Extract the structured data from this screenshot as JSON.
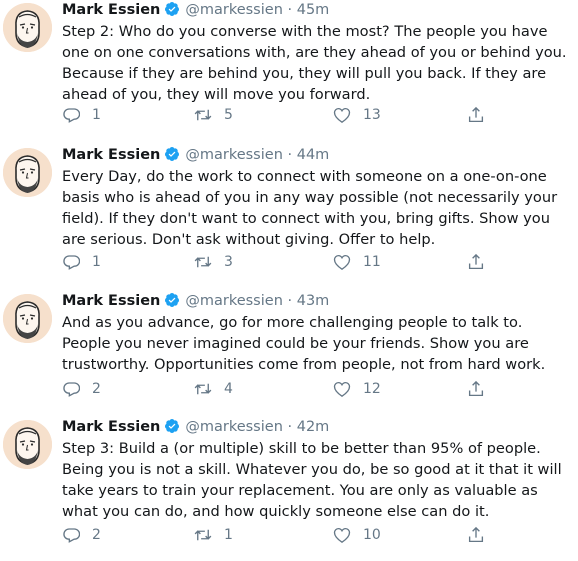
{
  "tweets": [
    {
      "name": "Mark Essien",
      "handle": "@markessien",
      "separator": "·",
      "time": "45m",
      "text": "Step 2: Who do you converse with the most? The people you have one on one conversations with, are they ahead of you or behind you. Because if they are behind you, they will pull you back. If they are ahead of you, they will move you forward.",
      "replies": "1",
      "retweets": "5",
      "likes": "13"
    },
    {
      "name": "Mark Essien",
      "handle": "@markessien",
      "separator": "·",
      "time": "44m",
      "text": "Every Day, do the work to connect with someone on a one-on-one basis who is ahead of you in any way possible (not necessarily your field). If they don't want to connect with you, bring gifts. Show you are serious. Don't ask without giving. Offer to help.",
      "replies": "1",
      "retweets": "3",
      "likes": "11"
    },
    {
      "name": "Mark Essien",
      "handle": "@markessien",
      "separator": "·",
      "time": "43m",
      "text": "And as you advance, go for more challenging people to talk to. People you never imagined could be your friends. Show you are trustworthy. Opportunities come from people, not from hard work.",
      "replies": "2",
      "retweets": "4",
      "likes": "12"
    },
    {
      "name": "Mark Essien",
      "handle": "@markessien",
      "separator": "·",
      "time": "42m",
      "text": "Step 3: Build a (or multiple) skill to be better than 95% of people. Being you is not a skill. Whatever you do, be so good at it that it will take years to train your replacement. You are only as valuable as what you can do, and how quickly someone else can do it.",
      "replies": "2",
      "retweets": "1",
      "likes": "10"
    }
  ],
  "colors": {
    "text": "#14171a",
    "secondary": "#657786",
    "verified": "#1da1f2"
  },
  "icons": [
    "avatar-illustration",
    "verified-badge-icon",
    "reply-icon",
    "retweet-icon",
    "like-icon",
    "share-icon"
  ]
}
